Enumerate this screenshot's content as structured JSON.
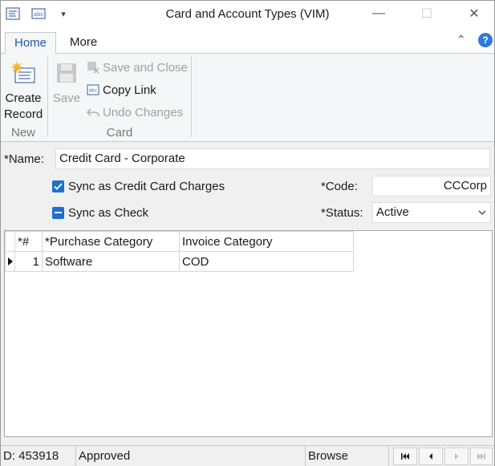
{
  "window": {
    "title": "Card and Account Types (VIM)",
    "minimize_glyph": "—",
    "maximize_glyph": "☐",
    "close_glyph": "✕"
  },
  "quick_access": {
    "dropdown_glyph": "▾"
  },
  "ribbon": {
    "tabs": [
      {
        "label": "Home",
        "active": true
      },
      {
        "label": "More",
        "active": false
      }
    ],
    "collapse_glyph": "⌃",
    "help_glyph": "?",
    "new_group": {
      "create_record_line1": "Create",
      "create_record_line2": "Record",
      "label": "New"
    },
    "card_group": {
      "save_label": "Save",
      "save_and_close_label": "Save and Close",
      "copy_link_label": "Copy Link",
      "undo_changes_label": "Undo Changes",
      "label": "Card"
    }
  },
  "form": {
    "name_label": "*Name:",
    "name_value": "Credit Card - Corporate",
    "sync_credit_card_label": "Sync as Credit Card Charges",
    "sync_credit_card_checked": true,
    "sync_check_label": "Sync as Check",
    "sync_check_state": "indeterminate",
    "code_label": "*Code:",
    "code_value": "CCCorp",
    "status_label": "*Status:",
    "status_value": "Active"
  },
  "grid": {
    "columns": [
      "*#",
      "*Purchase Category",
      "Invoice Category"
    ],
    "rows": [
      {
        "num": "1",
        "purchase_category": "Software",
        "invoice_category": "COD",
        "current": true
      }
    ]
  },
  "status_bar": {
    "id_text": "D: 453918",
    "state_text": "Approved",
    "mode_text": "Browse"
  },
  "colors": {
    "accent": "#1e6fd0",
    "tab_active_text": "#1e5aa8",
    "disabled_text": "#a0a0a0"
  }
}
